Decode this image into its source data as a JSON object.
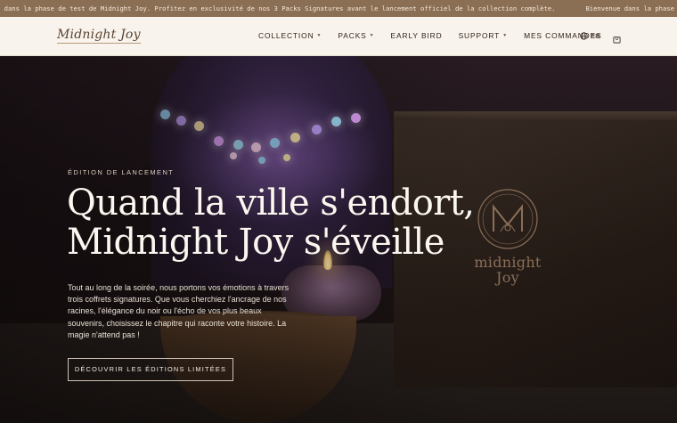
{
  "announcement": {
    "segments": [
      "e dans la phase de test de Midnight Joy. Profitez en exclusivité de nos 3 Packs Signatures avant le lancement officiel de la collection complète.",
      "Bienvenue dans la phase de test de Midnight Joy. Profitez en exc"
    ]
  },
  "header": {
    "logo": "Midnight Joy",
    "nav": [
      {
        "label": "COLLECTION",
        "dropdown": true
      },
      {
        "label": "PACKS",
        "dropdown": true
      },
      {
        "label": "EARLY BIRD",
        "dropdown": false
      },
      {
        "label": "SUPPORT",
        "dropdown": true
      },
      {
        "label": "MES COMMANDES",
        "dropdown": false
      }
    ],
    "language": "FR",
    "icons": {
      "language": "globe-icon",
      "cart": "shopping-bag-icon"
    }
  },
  "hero": {
    "eyebrow": "ÉDITION DE LANCEMENT",
    "headline_line1": "Quand la ville s'endort,",
    "headline_line2": "Midnight Joy s'éveille",
    "body": "Tout au long de la soirée, nous portons vos émotions à travers trois coffrets signatures. Que vous cherchiez l'ancrage de nos racines, l'élégance du noir ou l'écho de vos plus beaux souvenirs, choisissez le chapitre qui raconte votre histoire. La magie n'attend pas !",
    "cta": "DÉCOUVRIR LES ÉDITIONS LIMITÉES",
    "box_brand_line1": "midnight",
    "box_brand_line2": "Joy"
  },
  "colors": {
    "announcement_bg": "#8b6f55",
    "header_bg": "#f8f3ec",
    "hero_text": "#fbf6ef",
    "brand_mark": "#8a6f58"
  }
}
